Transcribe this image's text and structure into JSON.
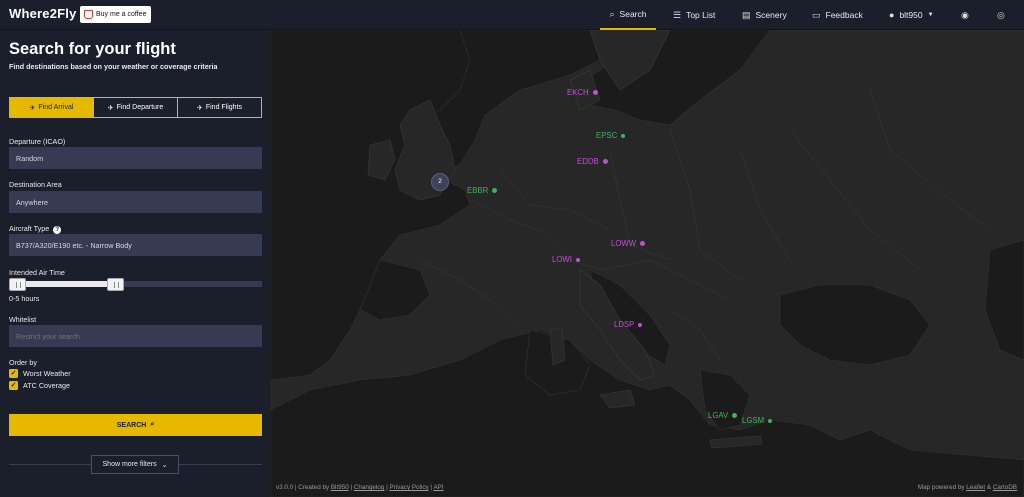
{
  "nav": {
    "logo": "Where2Fly",
    "coffee_label": "Buy me a coffee",
    "items": [
      {
        "label": "Search",
        "icon": "search-icon"
      },
      {
        "label": "Top List",
        "icon": "list-icon"
      },
      {
        "label": "Scenery",
        "icon": "map-icon"
      },
      {
        "label": "Feedback",
        "icon": "chat-icon"
      },
      {
        "label": "blt950",
        "icon": "user-icon"
      }
    ]
  },
  "sidebar": {
    "title": "Search for your flight",
    "subtitle": "Find destinations based on your weather or coverage criteria",
    "tabs": [
      {
        "label": "Find Arrival"
      },
      {
        "label": "Find Departure"
      },
      {
        "label": "Find Flights"
      }
    ],
    "departure": {
      "label": "Departure (ICAO)",
      "value": "Random"
    },
    "destination": {
      "label": "Destination Area",
      "value": "Anywhere"
    },
    "aircraft": {
      "label": "Aircraft Type",
      "value": "B737/A320/E190 etc. - Narrow Body"
    },
    "airtime": {
      "label": "Intended Air Time",
      "value": "0-5 hours",
      "min_hours": 0,
      "max_hours": 5
    },
    "whitelist": {
      "label": "Whitelist",
      "placeholder": "Restrict your search"
    },
    "order": {
      "label": "Order by",
      "options": [
        {
          "label": "Worst Weather",
          "checked": true
        },
        {
          "label": "ATC Coverage",
          "checked": true
        }
      ]
    },
    "search_label": "SEARCH",
    "more_filters_label": "Show more filters"
  },
  "map": {
    "cluster_count": "2",
    "markers": [
      {
        "code": "EKCH",
        "color": "#c24fd6"
      },
      {
        "code": "EPSC",
        "color": "#3cb55a"
      },
      {
        "code": "EDDB",
        "color": "#c24fd6"
      },
      {
        "code": "EBBR",
        "color": "#3cb55a"
      },
      {
        "code": "LOWW",
        "color": "#c24fd6"
      },
      {
        "code": "LOWI",
        "color": "#c24fd6"
      },
      {
        "code": "LDSP",
        "color": "#c24fd6"
      },
      {
        "code": "LGAV",
        "color": "#3cb55a"
      },
      {
        "code": "LGSM",
        "color": "#3cb55a"
      }
    ]
  },
  "footer": {
    "version": "v3.0.0 | Created by",
    "author": "Blt950",
    "sep": "|",
    "changelog": "Changelog",
    "privacy": "Privacy Policy",
    "api": "API",
    "map_powered": "Map powered by",
    "leaflet": "Leaflet",
    "amp": "&",
    "carto": "CartoDB"
  },
  "colors": {
    "accent": "#e6b800",
    "arrival": "#c24fd6",
    "departure": "#3cb55a"
  }
}
